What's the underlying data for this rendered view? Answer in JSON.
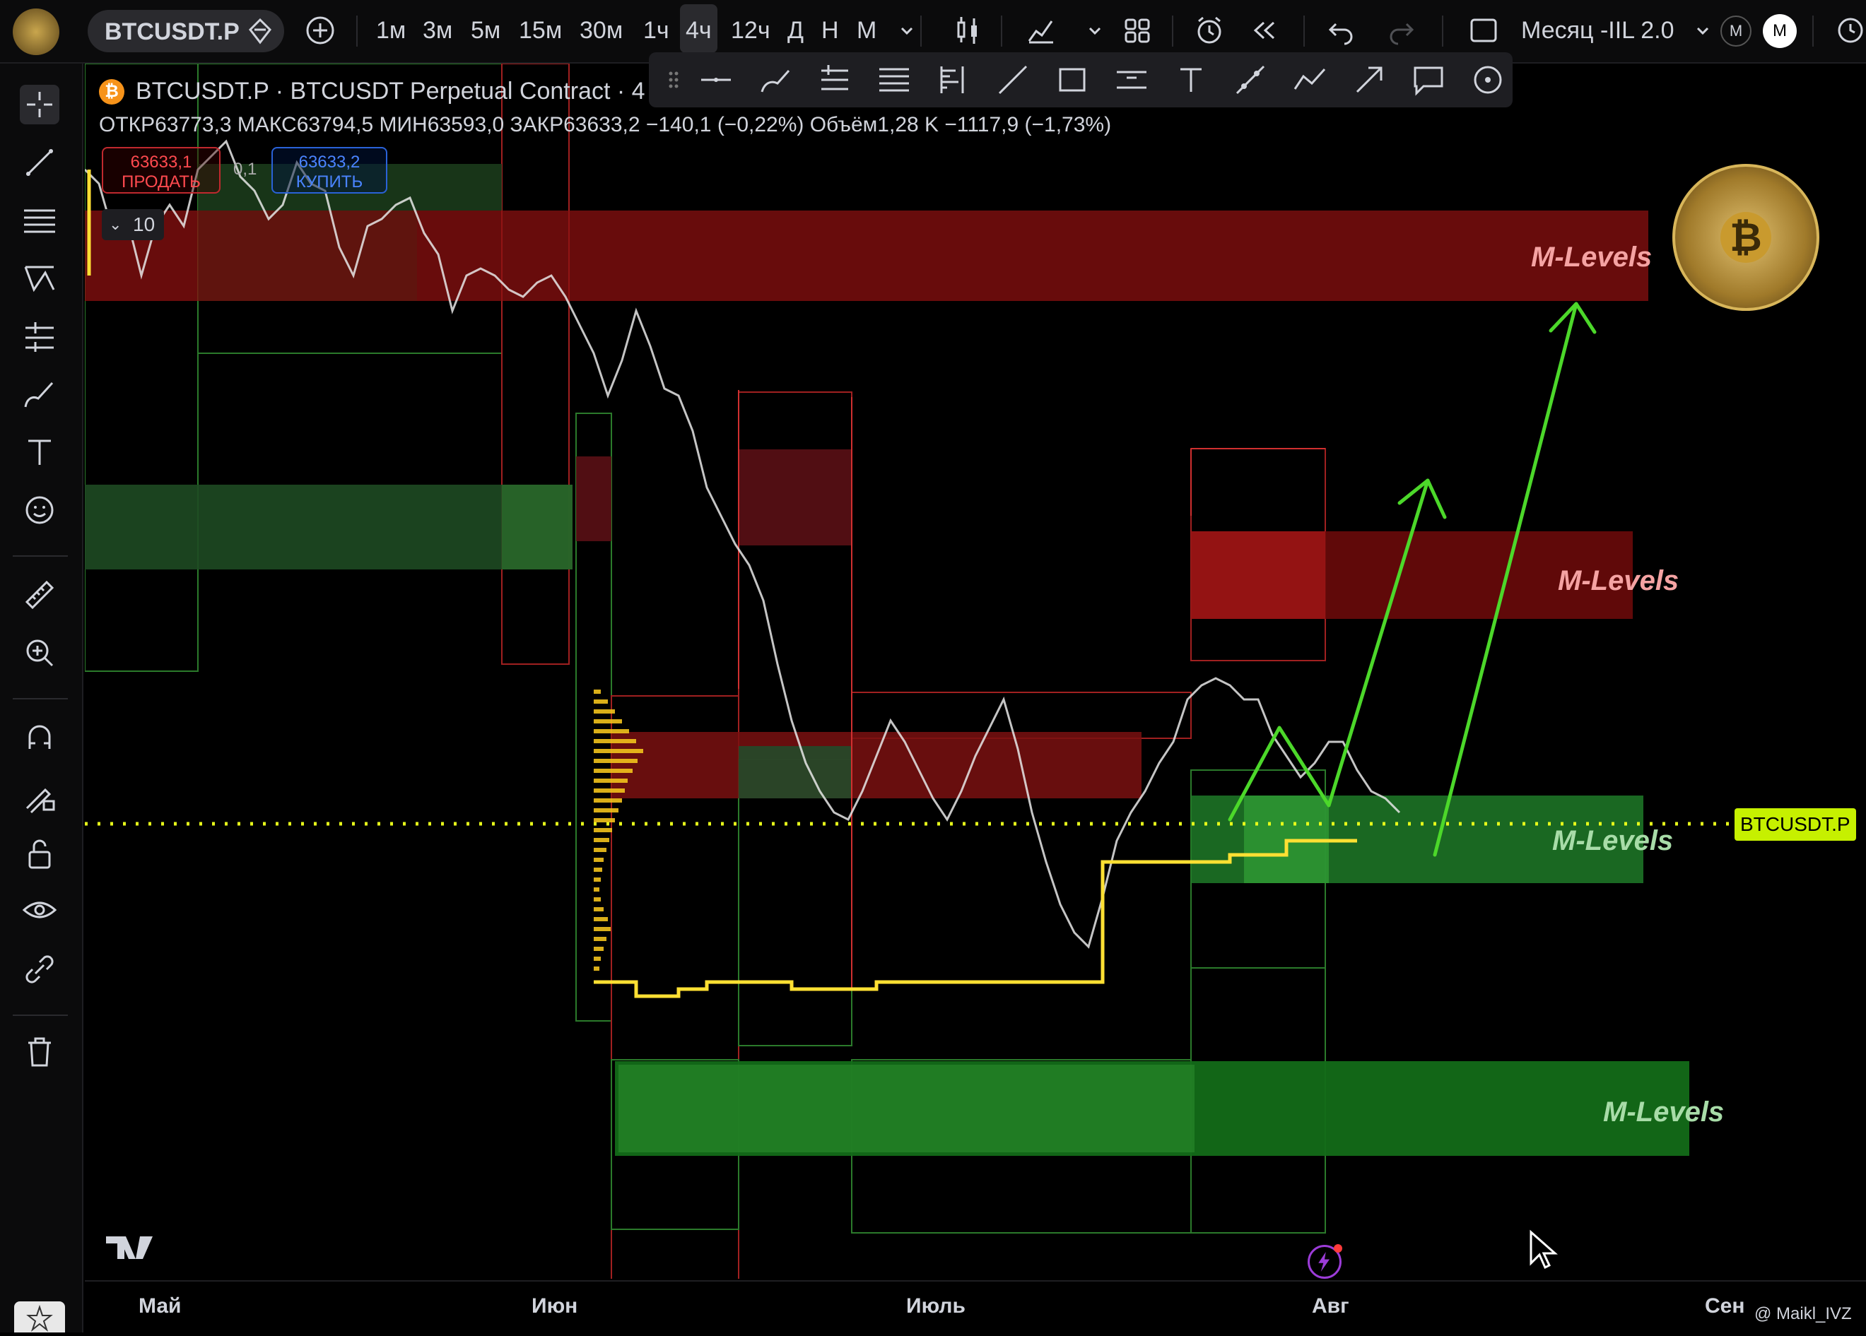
{
  "toolbar": {
    "symbol": "BTCUSDT.P",
    "timeframes": [
      "1м",
      "3м",
      "5м",
      "15м",
      "30м",
      "1ч",
      "4ч",
      "12ч",
      "Д",
      "Н",
      "М"
    ],
    "active_timeframe": "4ч",
    "layout_name": "Месяц -IIL 2.0",
    "avatar_letter_1": "M",
    "avatar_letter_2": "M"
  },
  "legend": {
    "title": "BTCUSDT.P · BTCUSDT Perpetual Contract · 4",
    "ohlc": "ОТКР63773,3 МАКС63794,5 МИН63593,0 ЗАКР63633,2 −140,1 (−0,22%) Объём1,28 K −1117,9 (−1,73%)",
    "sell_price": "63633,1",
    "sell_label": "ПРОДАТЬ",
    "spread": "0,1",
    "buy_price": "63633,2",
    "buy_label": "КУПИТЬ",
    "qty": "10"
  },
  "zones": {
    "label": "M-Levels"
  },
  "price_tag": "BTCUSDT.P",
  "xaxis": {
    "labels": [
      "Май",
      "Июн",
      "Июль",
      "Авг",
      "Сен"
    ]
  },
  "watermark": "@ Maikl_IVZ",
  "colors": {
    "red_zone": "#8b1010",
    "green_zone": "#1e7a28",
    "yellow": "#ffe033",
    "arrow_green": "#4cd82a",
    "price_tag_bg": "#c6f000"
  }
}
